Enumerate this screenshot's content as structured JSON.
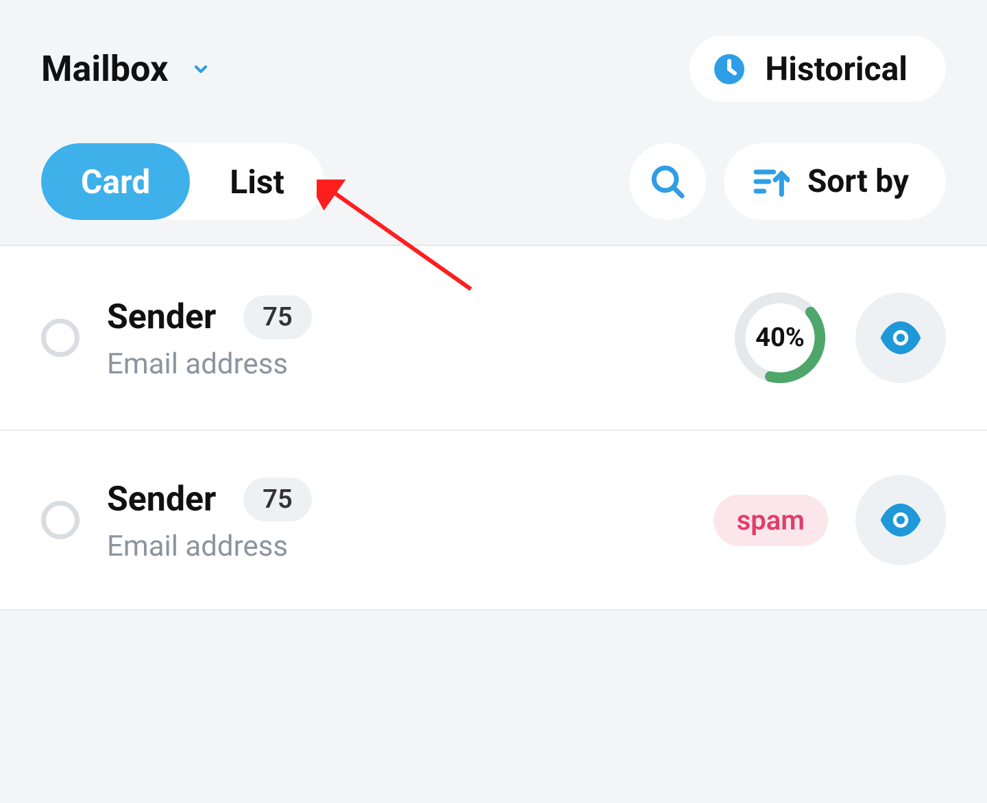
{
  "header": {
    "title": "Mailbox",
    "historical_label": "Historical"
  },
  "toolbar": {
    "view_card": "Card",
    "view_list": "List",
    "sort_label": "Sort by"
  },
  "icons": {
    "chevron_down": "chevron-down-icon",
    "clock": "clock-icon",
    "search": "search-icon",
    "sort": "sort-icon",
    "eye": "eye-icon"
  },
  "colors": {
    "accent": "#3eb0ea",
    "ring_green": "#4fa66b",
    "spam_bg": "#fbe6ec",
    "spam_text": "#e23d6b"
  },
  "rows": [
    {
      "sender": "Sender",
      "sub": "Email address",
      "count": "75",
      "ring_percent": 40,
      "ring_text": "40%",
      "spam": false
    },
    {
      "sender": "Sender",
      "sub": "Email address",
      "count": "75",
      "spam": true,
      "spam_label": "spam"
    }
  ]
}
